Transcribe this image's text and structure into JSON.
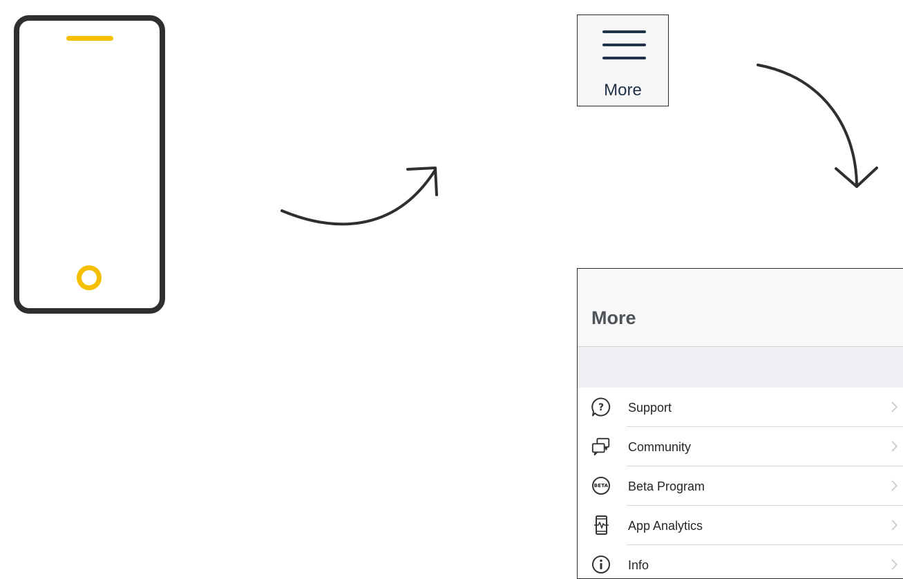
{
  "more_tab": {
    "label": "More",
    "icon": "hamburger-menu-icon"
  },
  "more_screen": {
    "title": "More",
    "items": [
      {
        "label": "Support",
        "icon": "support-question-icon"
      },
      {
        "label": "Community",
        "icon": "community-chat-icon"
      },
      {
        "label": "Beta Program",
        "icon": "beta-icon",
        "badge": "BETA"
      },
      {
        "label": "App Analytics",
        "icon": "app-analytics-icon"
      },
      {
        "label": "Info",
        "icon": "info-icon"
      }
    ]
  },
  "colors": {
    "accent_yellow": "#f5bf00",
    "outline_dark": "#2f2f2f",
    "navy": "#1f3247",
    "header_text": "#4d5358",
    "separator": "#d8d8d8",
    "chevron": "#c7c7cc"
  }
}
